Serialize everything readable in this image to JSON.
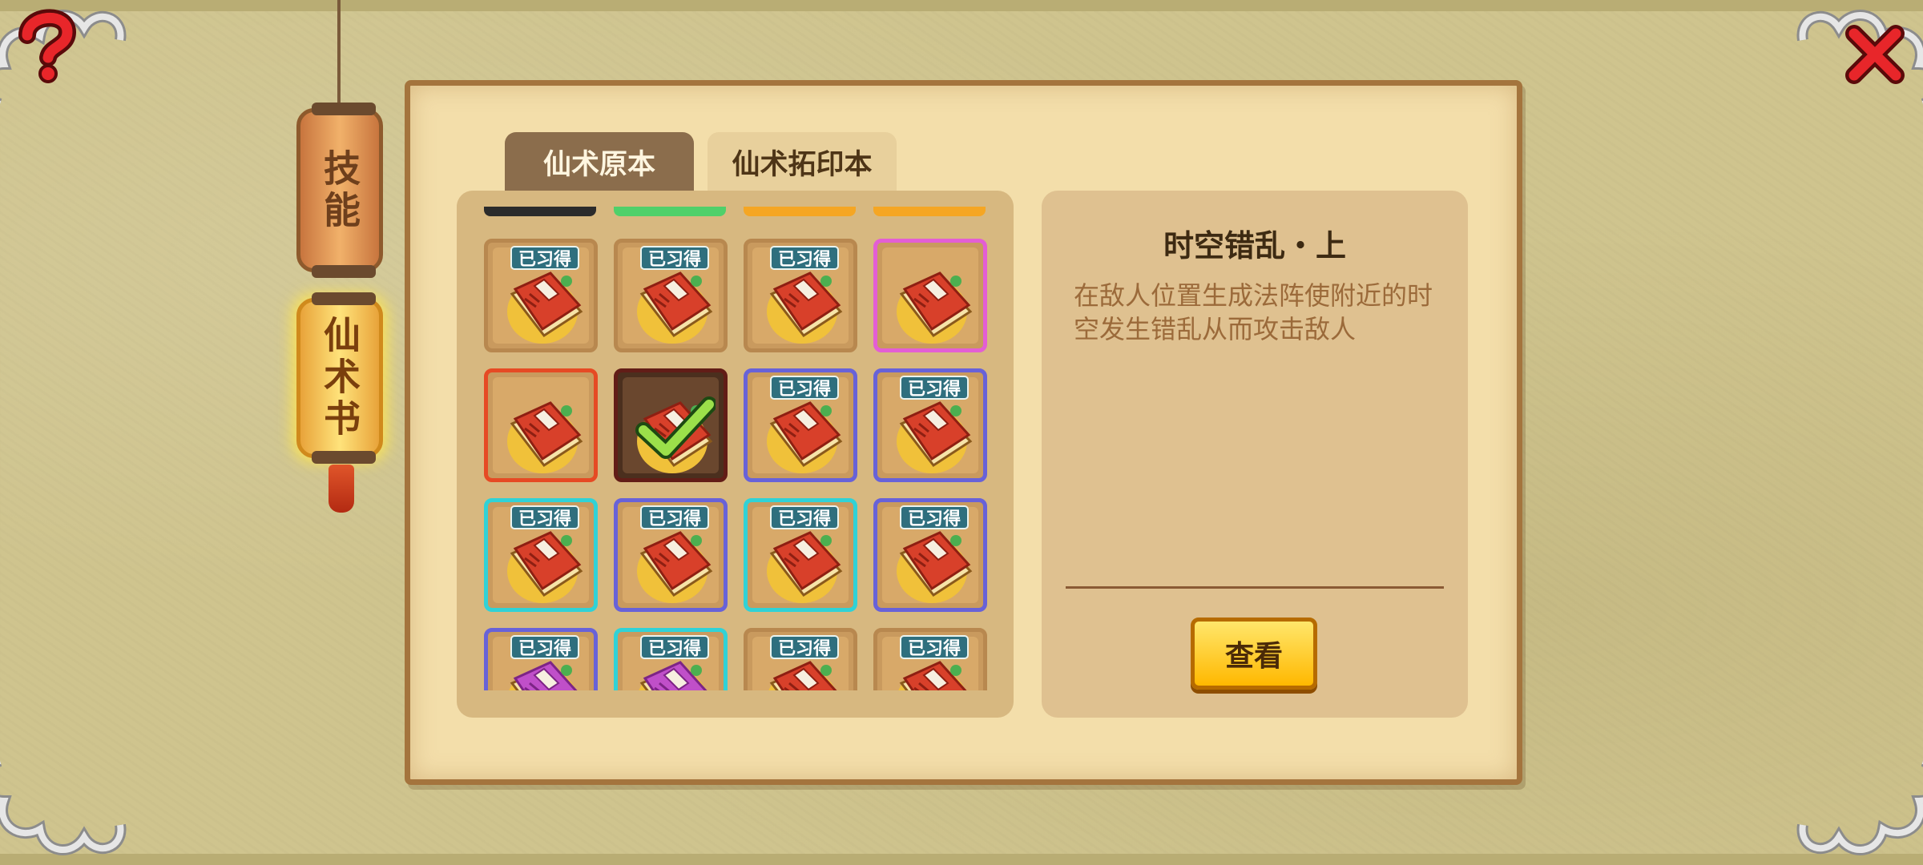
{
  "top_buttons": {
    "help": "?",
    "close": "×"
  },
  "lanterns": {
    "skill": "技能",
    "spell_book": "仙术书"
  },
  "tabs": [
    {
      "label": "仙术原本",
      "active": false
    },
    {
      "label": "仙术拓印本",
      "active": true
    }
  ],
  "grid": {
    "learned_tag": "已习得",
    "cutoff_row_colors": [
      "#2b2b2b",
      "#4fd06a",
      "#f5a623",
      "#f5a623"
    ],
    "slots": [
      {
        "rarity": "plain",
        "learned": true,
        "book": "red"
      },
      {
        "rarity": "plain",
        "learned": true,
        "book": "red"
      },
      {
        "rarity": "plain",
        "learned": true,
        "book": "red"
      },
      {
        "rarity": "pink",
        "learned": false,
        "book": "red"
      },
      {
        "rarity": "red",
        "learned": false,
        "book": "red"
      },
      {
        "rarity": "dark",
        "learned": false,
        "book": "red",
        "selected": true
      },
      {
        "rarity": "blue",
        "learned": true,
        "book": "red"
      },
      {
        "rarity": "blue",
        "learned": true,
        "book": "red"
      },
      {
        "rarity": "cyan",
        "learned": true,
        "book": "red"
      },
      {
        "rarity": "blue",
        "learned": true,
        "book": "red"
      },
      {
        "rarity": "cyan",
        "learned": true,
        "book": "red"
      },
      {
        "rarity": "blue",
        "learned": true,
        "book": "red"
      },
      {
        "rarity": "blue",
        "learned": true,
        "book": "purple"
      },
      {
        "rarity": "cyan",
        "learned": true,
        "book": "purple"
      },
      {
        "rarity": "plain",
        "learned": true,
        "book": "red"
      },
      {
        "rarity": "plain",
        "learned": true,
        "book": "red"
      }
    ]
  },
  "detail": {
    "title": "时空错乱・上",
    "description": "在敌人位置生成法阵使附近的时空发生错乱从而攻击敌人",
    "view_button": "查看"
  }
}
